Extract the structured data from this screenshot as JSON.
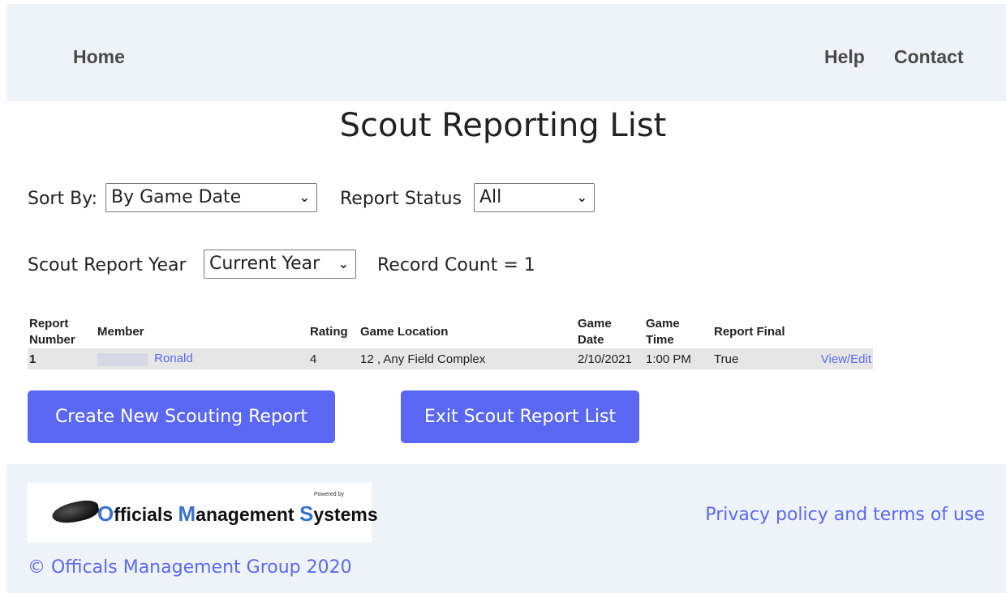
{
  "nav": {
    "home": "Home",
    "help": "Help",
    "contact": "Contact"
  },
  "page_title": "Scout Reporting List",
  "controls": {
    "sort_label": "Sort By:",
    "sort_value": "By Game Date",
    "status_label": "Report Status",
    "status_value": "All",
    "year_label": "Scout Report Year",
    "year_value": "Current Year",
    "record_count": "Record Count = 1"
  },
  "table": {
    "headers": {
      "report_number": [
        "Report",
        "Number"
      ],
      "member": "Member",
      "rating": "Rating",
      "location": "Game Location",
      "game_date": [
        "Game",
        "Date"
      ],
      "game_time": [
        "Game",
        "Time"
      ],
      "final": "Report Final"
    },
    "rows": [
      {
        "number": "1",
        "member": "Ronald",
        "rating": "4",
        "location": "12 , Any Field Complex",
        "date": "2/10/2021",
        "time": "1:00 PM",
        "final": "True",
        "action": "View/Edit"
      }
    ]
  },
  "buttons": {
    "create": "Create New Scouting Report",
    "exit": "Exit Scout Report List"
  },
  "footer": {
    "logo": {
      "powered": "Powered by",
      "o": "O",
      "fficials": "fficials ",
      "m": "M",
      "anagement": "anagement ",
      "s": "S",
      "ystems": "ystems"
    },
    "privacy": "Privacy policy and terms of use",
    "copyright": "© Officals Management Group 2020"
  },
  "colors": {
    "accent": "#5a67f2",
    "nav_bg": "#eef2f9",
    "link": "#5b6af2"
  }
}
